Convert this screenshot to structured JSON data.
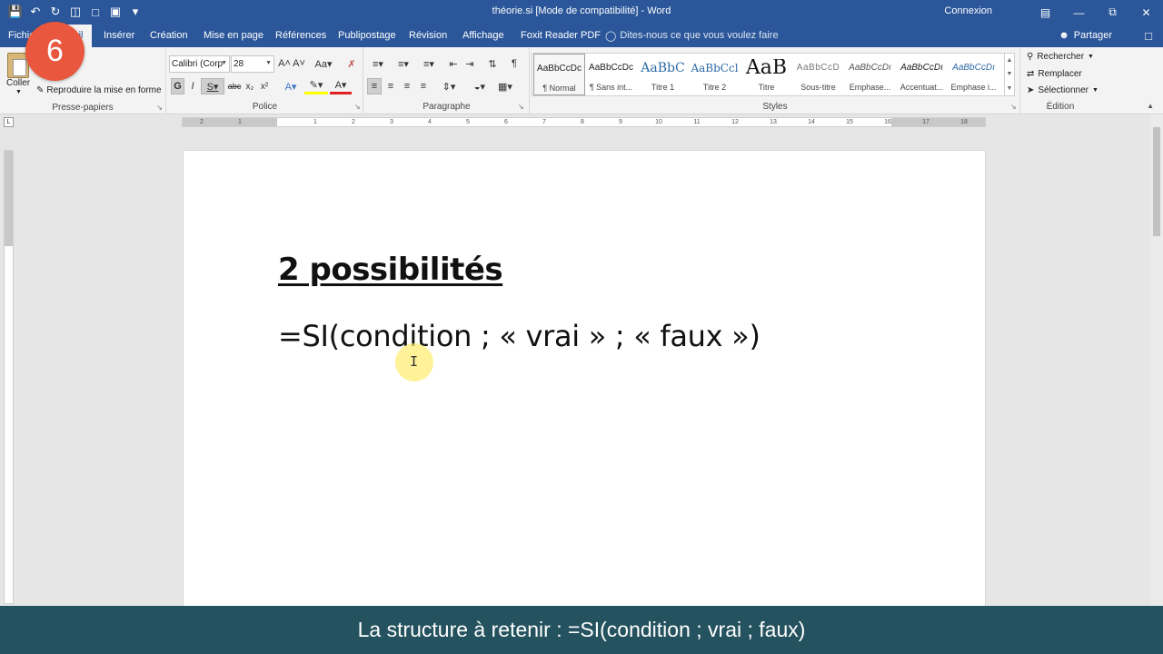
{
  "window": {
    "title": "théorie.si [Mode de compatibilité] - Word",
    "connexion": "Connexion"
  },
  "tabs": [
    {
      "label": "Fichier"
    },
    {
      "label": "Accueil"
    },
    {
      "label": "Insérer"
    },
    {
      "label": "Création"
    },
    {
      "label": "Mise en page"
    },
    {
      "label": "Références"
    },
    {
      "label": "Publipostage"
    },
    {
      "label": "Révision"
    },
    {
      "label": "Affichage"
    },
    {
      "label": "Foxit Reader PDF"
    }
  ],
  "active_tab": "Accueil",
  "tellme": "Dites-nous ce que vous voulez faire",
  "share": "Partager",
  "ribbon": {
    "clipboard": {
      "paste": "Coller",
      "format_painter": "Reproduire la mise en forme",
      "label": "Presse-papiers"
    },
    "font": {
      "name": "Calibri (Corp",
      "size": "28",
      "label": "Police"
    },
    "paragraph": {
      "label": "Paragraphe"
    },
    "styles": {
      "label": "Styles",
      "items": [
        {
          "preview": "AaBbCcDc",
          "name": "¶ Normal"
        },
        {
          "preview": "AaBbCcDc",
          "name": "¶ Sans int..."
        },
        {
          "preview": "AaBbC",
          "name": "Titre 1"
        },
        {
          "preview": "AaBbCcl",
          "name": "Titre 2"
        },
        {
          "preview": "AaB",
          "name": "Titre"
        },
        {
          "preview": "AaBbCcD",
          "name": "Sous-titre"
        },
        {
          "preview": "AaBbCcDı",
          "name": "Emphase..."
        },
        {
          "preview": "AaBbCcDı",
          "name": "Accentuat..."
        },
        {
          "preview": "AaBbCcDı",
          "name": "Emphase i..."
        }
      ]
    },
    "editing": {
      "label": "Édition",
      "find": "Rechercher",
      "replace": "Remplacer",
      "select": "Sélectionner"
    }
  },
  "ruler": {
    "numbers": [
      "2",
      "1",
      "1",
      "2",
      "3",
      "4",
      "5",
      "6",
      "7",
      "8",
      "9",
      "10",
      "11",
      "12",
      "13",
      "14",
      "15",
      "16",
      "17",
      "18"
    ]
  },
  "document": {
    "heading": "2 possibilités",
    "formula": "=SI(condition ; « vrai » ; « faux »)"
  },
  "step_badge": "6",
  "caption": "La structure à retenir : =SI(condition ; vrai ; faux)",
  "colors": {
    "word_blue": "#2b579a",
    "badge": "#e8573e",
    "caption_bg": "#24525e",
    "cursor_highlight": "#ffec6e"
  }
}
